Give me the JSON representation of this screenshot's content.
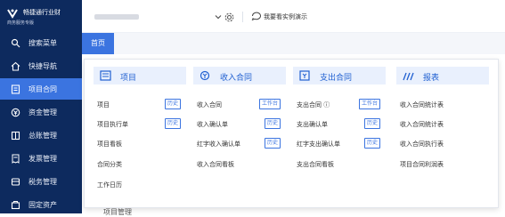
{
  "brand": {
    "name": "畅捷通行业财",
    "subtitle": "商务服务专版"
  },
  "sidebar": {
    "items": [
      {
        "label": "搜索菜单",
        "icon": "search-icon"
      },
      {
        "label": "快捷导航",
        "icon": "home-icon"
      },
      {
        "label": "项目合同",
        "icon": "contract-icon",
        "active": true
      },
      {
        "label": "资金管理",
        "icon": "money-icon"
      },
      {
        "label": "总账管理",
        "icon": "ledger-icon"
      },
      {
        "label": "发票管理",
        "icon": "invoice-icon"
      },
      {
        "label": "税务管理",
        "icon": "tax-icon"
      },
      {
        "label": "固定资产",
        "icon": "asset-icon"
      }
    ]
  },
  "topbar": {
    "demo_label": "我要看实例演示"
  },
  "tabs": {
    "home": "首页"
  },
  "menu": {
    "columns": [
      {
        "title": "项目",
        "items": [
          {
            "label": "项目",
            "tag": "历史"
          },
          {
            "label": "项目执行单",
            "tag": "历史"
          },
          {
            "label": "项目看板"
          },
          {
            "label": "合同分类"
          },
          {
            "label": "工作日历"
          }
        ]
      },
      {
        "title": "收入合同",
        "items": [
          {
            "label": "收入合同",
            "tag": "工作台"
          },
          {
            "label": "收入确认单",
            "tag": "历史"
          },
          {
            "label": "红字收入确认单",
            "tag": "历史"
          },
          {
            "label": "收入合同看板"
          }
        ]
      },
      {
        "title": "支出合同",
        "items": [
          {
            "label": "支出合同 ⓘ",
            "tag": "工作台"
          },
          {
            "label": "支出确认单",
            "tag": "历史"
          },
          {
            "label": "红字支出确认单",
            "tag": "历史"
          },
          {
            "label": "支出合同看板"
          }
        ]
      },
      {
        "title": "报表",
        "items": [
          {
            "label": "收入合同统计表"
          },
          {
            "label": "收入合同统计表"
          },
          {
            "label": "收入合同执行表"
          },
          {
            "label": "项目合同利润表"
          }
        ]
      }
    ]
  },
  "background_text": "项目管理",
  "colors": {
    "sidebar_bg": "#0d2a5e",
    "accent": "#3b74e0",
    "menu_head_bg": "#e9f0fd"
  }
}
